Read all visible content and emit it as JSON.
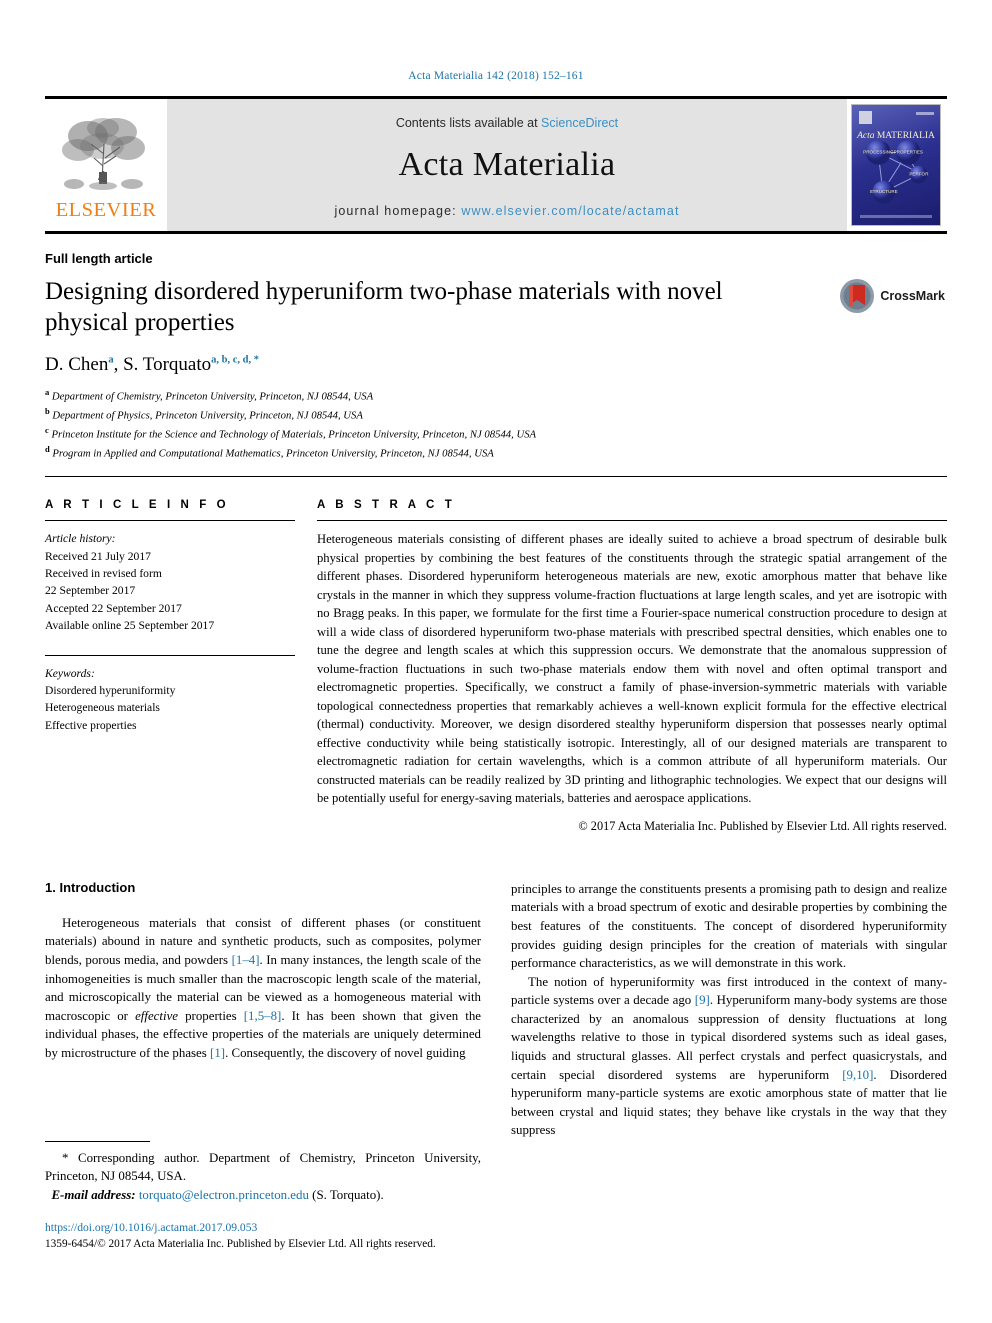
{
  "running_head": "Acta Materialia 142 (2018) 152–161",
  "masthead": {
    "contents_prefix": "Contents lists available at",
    "contents_link": "ScienceDirect",
    "journal_name": "Acta Materialia",
    "homepage_prefix": "journal homepage:",
    "homepage_link": "www.elsevier.com/locate/actamat",
    "publisher_logo_word": "ELSEVIER",
    "cover_title_italic": "Acta",
    "cover_title_rest": "MATERIALIA",
    "cover_node_labels": [
      "PROCESSING",
      "PROPERTIES",
      "PERFORMANCE",
      "STRUCTURE"
    ]
  },
  "article": {
    "type": "Full length article",
    "title": "Designing disordered hyperuniform two-phase materials with novel physical properties",
    "crossmark_label": "CrossMark",
    "authors": [
      {
        "name": "D. Chen",
        "marks": "a"
      },
      {
        "name": "S. Torquato",
        "marks": "a, b, c, d, *"
      }
    ],
    "affiliations": [
      {
        "mark": "a",
        "text": "Department of Chemistry, Princeton University, Princeton, NJ 08544, USA"
      },
      {
        "mark": "b",
        "text": "Department of Physics, Princeton University, Princeton, NJ 08544, USA"
      },
      {
        "mark": "c",
        "text": "Princeton Institute for the Science and Technology of Materials, Princeton University, Princeton, NJ 08544, USA"
      },
      {
        "mark": "d",
        "text": "Program in Applied and Computational Mathematics, Princeton University, Princeton, NJ 08544, USA"
      }
    ]
  },
  "article_info": {
    "heading": "A R T I C L E  I N F O",
    "history_label": "Article history:",
    "history": [
      "Received 21 July 2017",
      "Received in revised form",
      "22 September 2017",
      "Accepted 22 September 2017",
      "Available online 25 September 2017"
    ],
    "keywords_label": "Keywords:",
    "keywords": [
      "Disordered hyperuniformity",
      "Heterogeneous materials",
      "Effective properties"
    ]
  },
  "abstract": {
    "heading": "A B S T R A C T",
    "text": "Heterogeneous materials consisting of different phases are ideally suited to achieve a broad spectrum of desirable bulk physical properties by combining the best features of the constituents through the strategic spatial arrangement of the different phases. Disordered hyperuniform heterogeneous materials are new, exotic amorphous matter that behave like crystals in the manner in which they suppress volume-fraction fluctuations at large length scales, and yet are isotropic with no Bragg peaks. In this paper, we formulate for the first time a Fourier-space numerical construction procedure to design at will a wide class of disordered hyperuniform two-phase materials with prescribed spectral densities, which enables one to tune the degree and length scales at which this suppression occurs. We demonstrate that the anomalous suppression of volume-fraction fluctuations in such two-phase materials endow them with novel and often optimal transport and electromagnetic properties. Specifically, we construct a family of phase-inversion-symmetric materials with variable topological connectedness properties that remarkably achieves a well-known explicit formula for the effective electrical (thermal) conductivity. Moreover, we design disordered stealthy hyperuniform dispersion that possesses nearly optimal effective conductivity while being statistically isotropic. Interestingly, all of our designed materials are transparent to electromagnetic radiation for certain wavelengths, which is a common attribute of all hyperuniform materials. Our constructed materials can be readily realized by 3D printing and lithographic technologies. We expect that our designs will be potentially useful for energy-saving materials, batteries and aerospace applications.",
    "copyright": "© 2017 Acta Materialia Inc. Published by Elsevier Ltd. All rights reserved."
  },
  "introduction": {
    "heading": "1. Introduction",
    "left_paragraph_parts": [
      "Heterogeneous materials that consist of different phases (or constituent materials) abound in nature and synthetic products, such as composites, polymer blends, porous media, and powders ",
      "[1–4]",
      ". In many instances, the length scale of the inhomogeneities is much smaller than the macroscopic length scale of the material, and microscopically the material can be viewed as a homogeneous material with macroscopic or ",
      "effective",
      " properties ",
      "[1,5–8]",
      ". It has been shown that given the individual phases, the effective properties of the materials are uniquely determined by microstructure of the phases ",
      "[1]",
      ". Consequently, the discovery of novel guiding"
    ],
    "right_paragraph_1": "principles to arrange the constituents presents a promising path to design and realize materials with a broad spectrum of exotic and desirable properties by combining the best features of the constituents. The concept of disordered hyperuniformity provides guiding design principles for the creation of materials with singular performance characteristics, as we will demonstrate in this work.",
    "right_paragraph_2_parts": [
      "The notion of hyperuniformity was first introduced in the context of many-particle systems over a decade ago ",
      "[9]",
      ". Hyperuniform many-body systems are those characterized by an anomalous suppression of density fluctuations at long wavelengths relative to those in typical disordered systems such as ideal gases, liquids and structural glasses. All perfect crystals and perfect quasicrystals, and certain special disordered systems are hyperuniform ",
      "[9,10]",
      ". Disordered hyperuniform many-particle systems are exotic amorphous state of matter that lie between crystal and liquid states; they behave like crystals in the way that they suppress"
    ]
  },
  "footnote": {
    "star": "*",
    "corresponding_text": "Corresponding author. Department of Chemistry, Princeton University, Princeton, NJ 08544, USA.",
    "email_label": "E-mail address:",
    "email": "torquato@electron.princeton.edu",
    "email_suffix": "(S. Torquato)."
  },
  "footer": {
    "doi": "https://doi.org/10.1016/j.actamat.2017.09.053",
    "issn_line": "1359-6454/© 2017 Acta Materialia Inc. Published by Elsevier Ltd. All rights reserved."
  },
  "colors": {
    "link": "#1a74a8",
    "elsevier_orange": "#f07f13",
    "masthead_bg": "#e3e3e3"
  }
}
